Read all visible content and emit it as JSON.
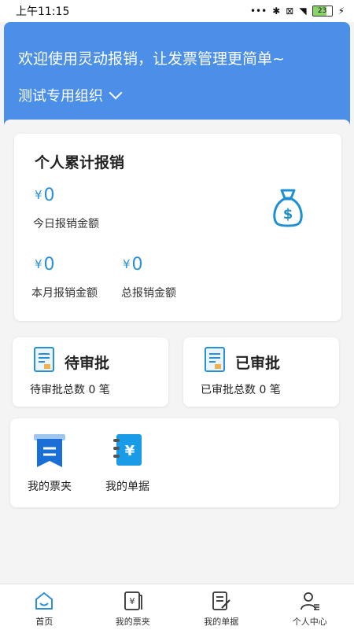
{
  "status": {
    "time": "上午11:15",
    "battery": "23"
  },
  "header": {
    "welcome": "欢迎使用灵动报销，让发票管理更简单~",
    "org": "测试专用组织"
  },
  "stats": {
    "title": "个人累计报销",
    "today": {
      "value": "0",
      "label": "今日报销金额"
    },
    "month": {
      "value": "0",
      "label": "本月报销金额"
    },
    "total": {
      "value": "0",
      "label": "总报销金额"
    },
    "currency": "¥"
  },
  "approval": {
    "pending": {
      "title": "待审批",
      "count_text": "待审批总数 0 笔"
    },
    "done": {
      "title": "已审批",
      "count_text": "已审批总数 0 笔"
    }
  },
  "tools": [
    {
      "label": "我的票夹",
      "icon": "receipt-folder-icon"
    },
    {
      "label": "我的单据",
      "icon": "document-yen-icon"
    }
  ],
  "tabbar": [
    {
      "label": "首页",
      "icon": "home-icon",
      "active": true
    },
    {
      "label": "我的票夹",
      "icon": "receipt-icon",
      "active": false
    },
    {
      "label": "我的单据",
      "icon": "edit-document-icon",
      "active": false
    },
    {
      "label": "个人中心",
      "icon": "user-icon",
      "active": false
    }
  ],
  "colors": {
    "accent": "#4b8fe8",
    "money": "#2b8fd8"
  }
}
